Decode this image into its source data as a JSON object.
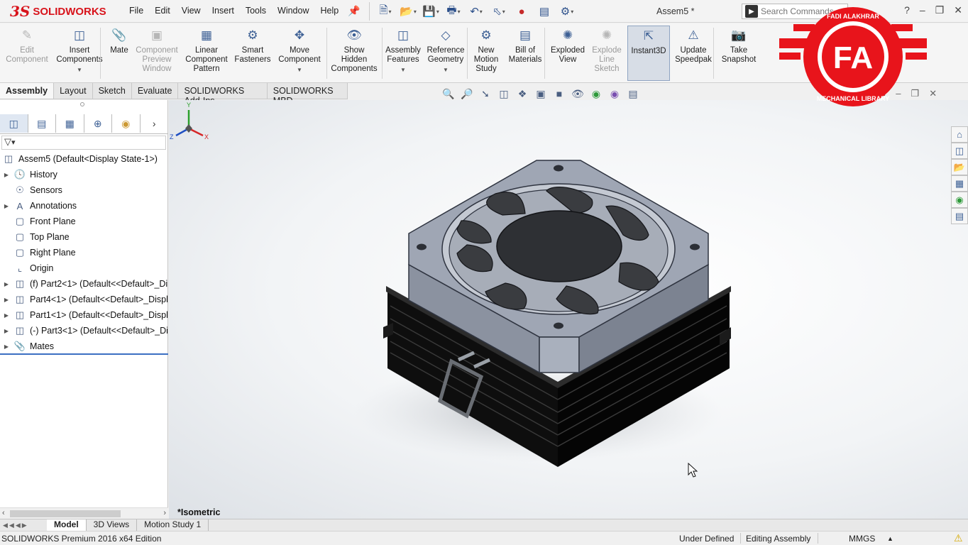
{
  "app": {
    "brand_mark": "3S",
    "brand_name": "SOLIDWORKS",
    "document_title": "Assem5 *",
    "menu": [
      "File",
      "Edit",
      "View",
      "Insert",
      "Tools",
      "Window",
      "Help"
    ],
    "search_placeholder": "Search Commands"
  },
  "ribbon": [
    {
      "label": "Edit\nComponent",
      "icon": "edit-component-icon",
      "disabled": true
    },
    {
      "label": "Insert\nComponents",
      "icon": "insert-components-icon",
      "disabled": false,
      "dropdown": true
    },
    {
      "label": "Mate",
      "icon": "mate-icon",
      "disabled": false
    },
    {
      "label": "Component\nPreview\nWindow",
      "icon": "preview-window-icon",
      "disabled": true
    },
    {
      "label": "Linear\nComponent\nPattern",
      "icon": "linear-pattern-icon",
      "disabled": false
    },
    {
      "label": "Smart\nFasteners",
      "icon": "smart-fasteners-icon",
      "disabled": false
    },
    {
      "label": "Move\nComponent",
      "icon": "move-component-icon",
      "disabled": false,
      "dropdown": true
    },
    {
      "label": "Show\nHidden\nComponents",
      "icon": "show-hidden-icon",
      "disabled": false
    },
    {
      "label": "Assembly\nFeatures",
      "icon": "assembly-features-icon",
      "disabled": false,
      "dropdown": true
    },
    {
      "label": "Reference\nGeometry",
      "icon": "reference-geometry-icon",
      "disabled": false,
      "dropdown": true
    },
    {
      "label": "New\nMotion\nStudy",
      "icon": "motion-study-icon",
      "disabled": false
    },
    {
      "label": "Bill of\nMaterials",
      "icon": "bill-of-materials-icon",
      "disabled": false
    },
    {
      "label": "Exploded\nView",
      "icon": "exploded-view-icon",
      "disabled": false
    },
    {
      "label": "Explode\nLine\nSketch",
      "icon": "explode-line-icon",
      "disabled": true
    },
    {
      "label": "Instant3D",
      "icon": "instant3d-icon",
      "disabled": false,
      "active": true
    },
    {
      "label": "Update\nSpeedpak",
      "icon": "speedpak-icon",
      "disabled": false
    },
    {
      "label": "Take\nSnapshot",
      "icon": "camera-icon",
      "disabled": false
    }
  ],
  "tabs": [
    "Assembly",
    "Layout",
    "Sketch",
    "Evaluate",
    "SOLIDWORKS Add-Ins",
    "SOLIDWORKS MBD"
  ],
  "active_tab": "Assembly",
  "tree": {
    "root": "Assem5  (Default<Display State-1>)",
    "items": [
      {
        "label": "History",
        "icon": "history-icon",
        "expandable": true
      },
      {
        "label": "Sensors",
        "icon": "sensors-icon",
        "expandable": false
      },
      {
        "label": "Annotations",
        "icon": "annotations-icon",
        "expandable": true
      },
      {
        "label": "Front Plane",
        "icon": "plane-icon",
        "expandable": false
      },
      {
        "label": "Top Plane",
        "icon": "plane-icon",
        "expandable": false
      },
      {
        "label": "Right Plane",
        "icon": "plane-icon",
        "expandable": false
      },
      {
        "label": "Origin",
        "icon": "origin-icon",
        "expandable": false
      },
      {
        "label": "(f) Part2<1> (Default<<Default>_Di",
        "icon": "part-icon",
        "expandable": true
      },
      {
        "label": "Part4<1> (Default<<Default>_Displ",
        "icon": "part-icon",
        "expandable": true
      },
      {
        "label": "Part1<1> (Default<<Default>_Displ",
        "icon": "part-icon",
        "expandable": true
      },
      {
        "label": "(-) Part3<1> (Default<<Default>_Di",
        "icon": "part-icon",
        "expandable": true
      },
      {
        "label": "Mates",
        "icon": "mates-icon",
        "expandable": true
      }
    ]
  },
  "viewport": {
    "view_label": "*Isometric",
    "triad": {
      "x": "X",
      "y": "Y",
      "z": "Z"
    }
  },
  "bottom_tabs": [
    "Model",
    "3D Views",
    "Motion Study 1"
  ],
  "active_bottom_tab": "Model",
  "status": {
    "edition": "SOLIDWORKS Premium 2016 x64 Edition",
    "definition": "Under Defined",
    "mode": "Editing Assembly",
    "units": "MMGS"
  },
  "watermark": {
    "initials": "FA",
    "top_text": "FADI ALAKHRAR",
    "bottom_text": "MECHANICAL LIBRARY",
    "color": "#e8141b"
  },
  "colors": {
    "brand": "#d8131b",
    "accent": "#3b6fc2"
  }
}
